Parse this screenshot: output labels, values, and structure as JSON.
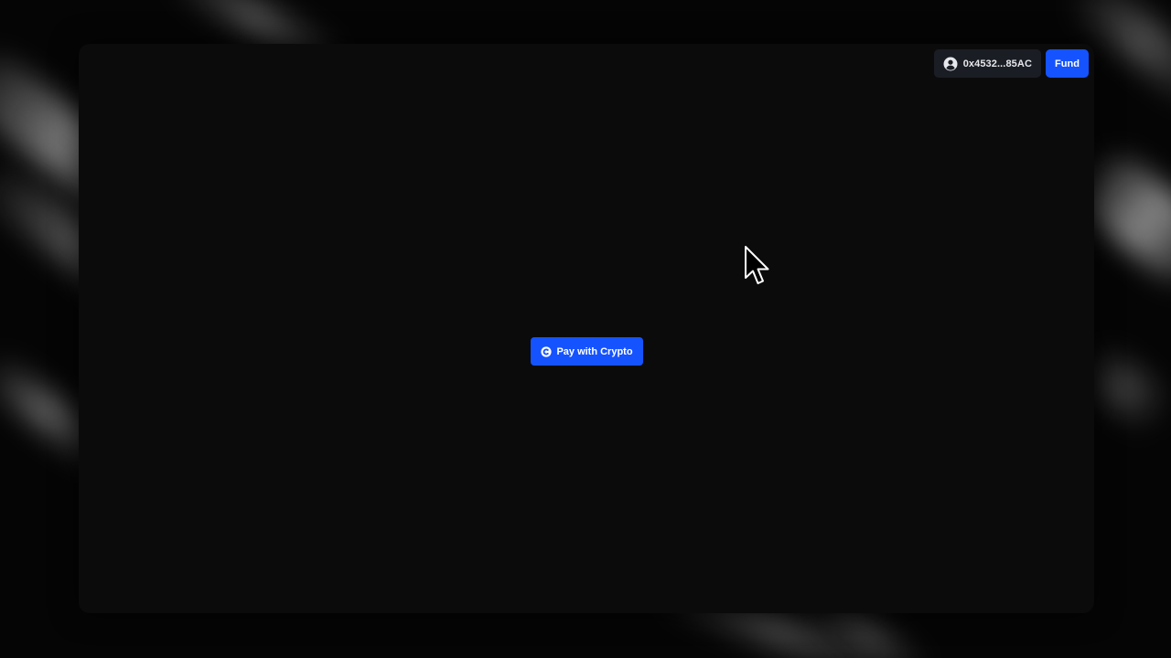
{
  "header": {
    "wallet": {
      "address": "0x4532...85AC",
      "icon": "user-avatar-icon"
    },
    "fund_label": "Fund"
  },
  "main": {
    "pay_button": {
      "label": "Pay with Crypto",
      "icon": "coinbase-coin-icon"
    }
  },
  "colors": {
    "accent": "#1553ff",
    "window_bg": "#0b0b0c",
    "wallet_bg": "#1a1d24"
  }
}
